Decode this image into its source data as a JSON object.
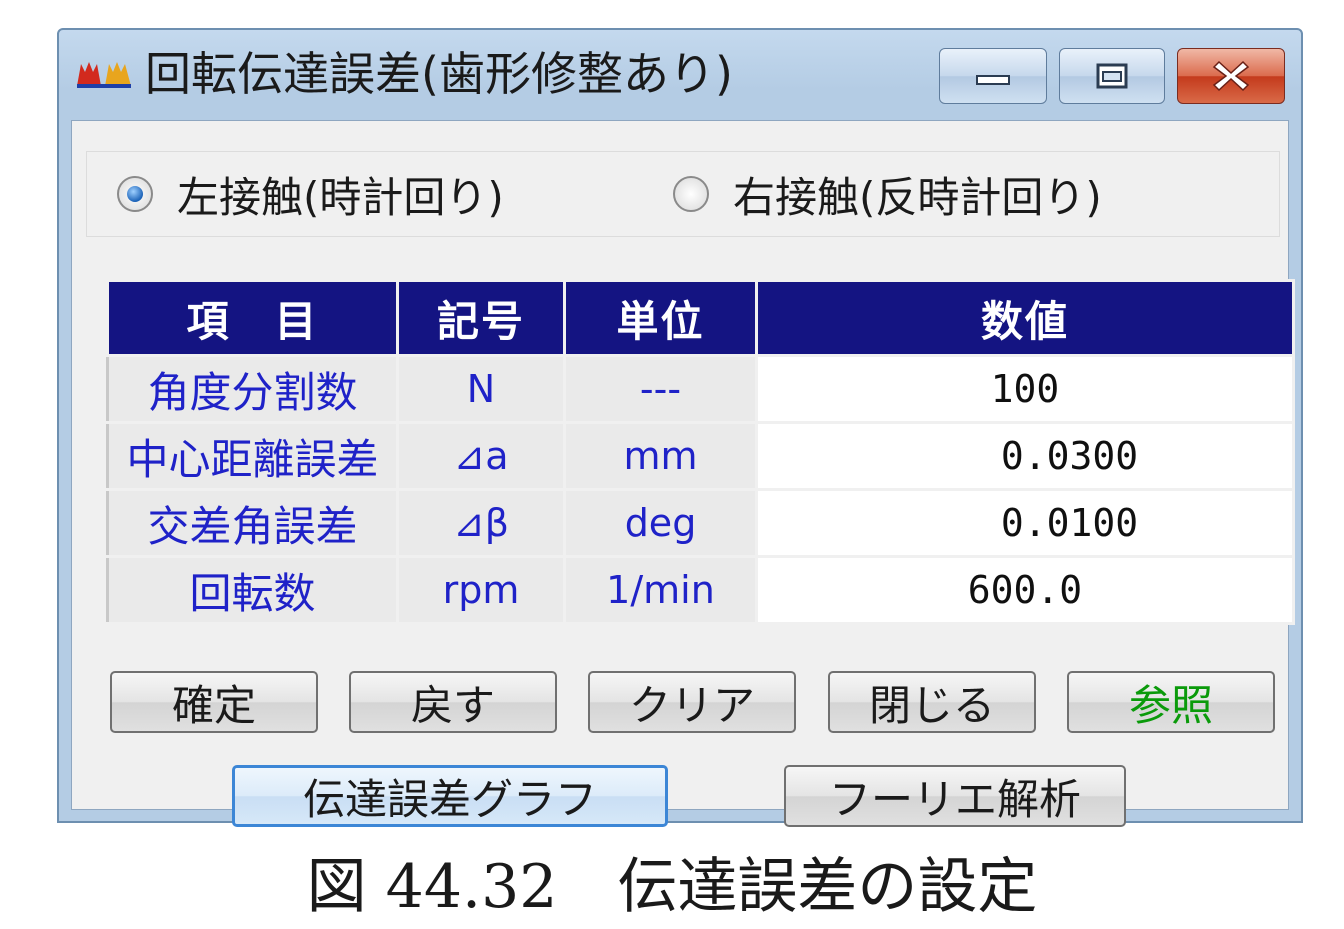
{
  "window": {
    "title": "回転伝達誤差(歯形修整あり)",
    "accent_color": "#141482"
  },
  "contact": {
    "left_label": "左接触(時計回り)",
    "right_label": "右接触(反時計回り)",
    "selected": "left"
  },
  "table": {
    "headers": [
      "項　目",
      "記号",
      "単位",
      "数値"
    ],
    "rows": [
      {
        "item": "角度分割数",
        "symbol": "N",
        "unit": "---",
        "value": "100"
      },
      {
        "item": "中心距離誤差",
        "symbol": "⊿a",
        "unit": "mm",
        "value": "0.0300"
      },
      {
        "item": "交差角誤差",
        "symbol": "⊿β",
        "unit": "deg",
        "value": "0.0100"
      },
      {
        "item": "回転数",
        "symbol": "rpm",
        "unit": "1/min",
        "value": "600.0"
      }
    ]
  },
  "buttons": {
    "confirm": "確定",
    "back": "戻す",
    "clear": "クリア",
    "close": "閉じる",
    "reference": "参照",
    "graph": "伝達誤差グラフ",
    "fourier": "フーリエ解析"
  },
  "caption": "図 44.32　伝達誤差の設定"
}
